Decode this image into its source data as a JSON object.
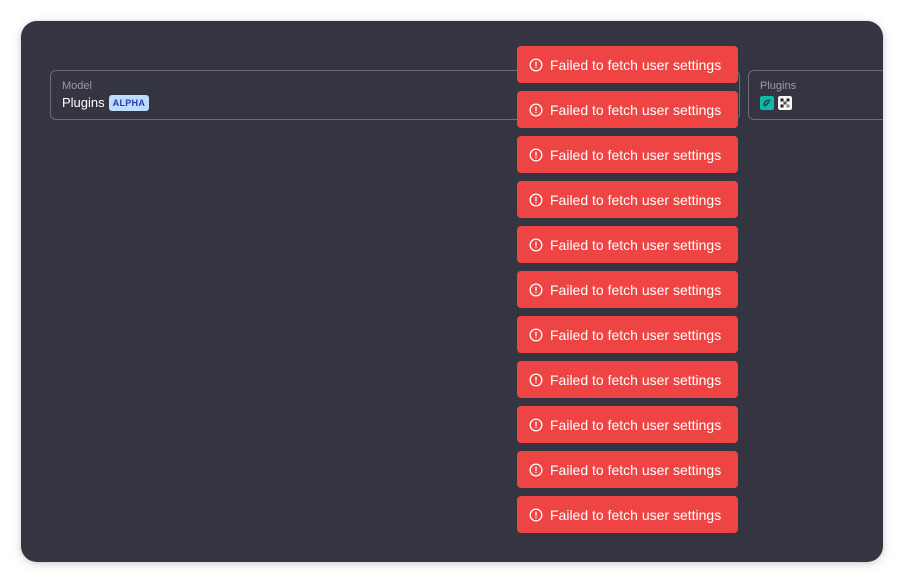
{
  "model_select": {
    "label": "Model",
    "value": "Plugins",
    "badge": "ALPHA"
  },
  "plugins_select": {
    "label": "Plugins",
    "icons": [
      "teal-plugin-icon",
      "white-grid-plugin-icon"
    ]
  },
  "toasts": [
    {
      "message": "Failed to fetch user settings"
    },
    {
      "message": "Failed to fetch user settings"
    },
    {
      "message": "Failed to fetch user settings"
    },
    {
      "message": "Failed to fetch user settings"
    },
    {
      "message": "Failed to fetch user settings"
    },
    {
      "message": "Failed to fetch user settings"
    },
    {
      "message": "Failed to fetch user settings"
    },
    {
      "message": "Failed to fetch user settings"
    },
    {
      "message": "Failed to fetch user settings"
    },
    {
      "message": "Failed to fetch user settings"
    },
    {
      "message": "Failed to fetch user settings"
    }
  ],
  "colors": {
    "background": "#343541",
    "toast": "#ef4444",
    "badge_bg": "#bfdbfe",
    "badge_text": "#1e40af",
    "border": "#6b6c7b"
  }
}
